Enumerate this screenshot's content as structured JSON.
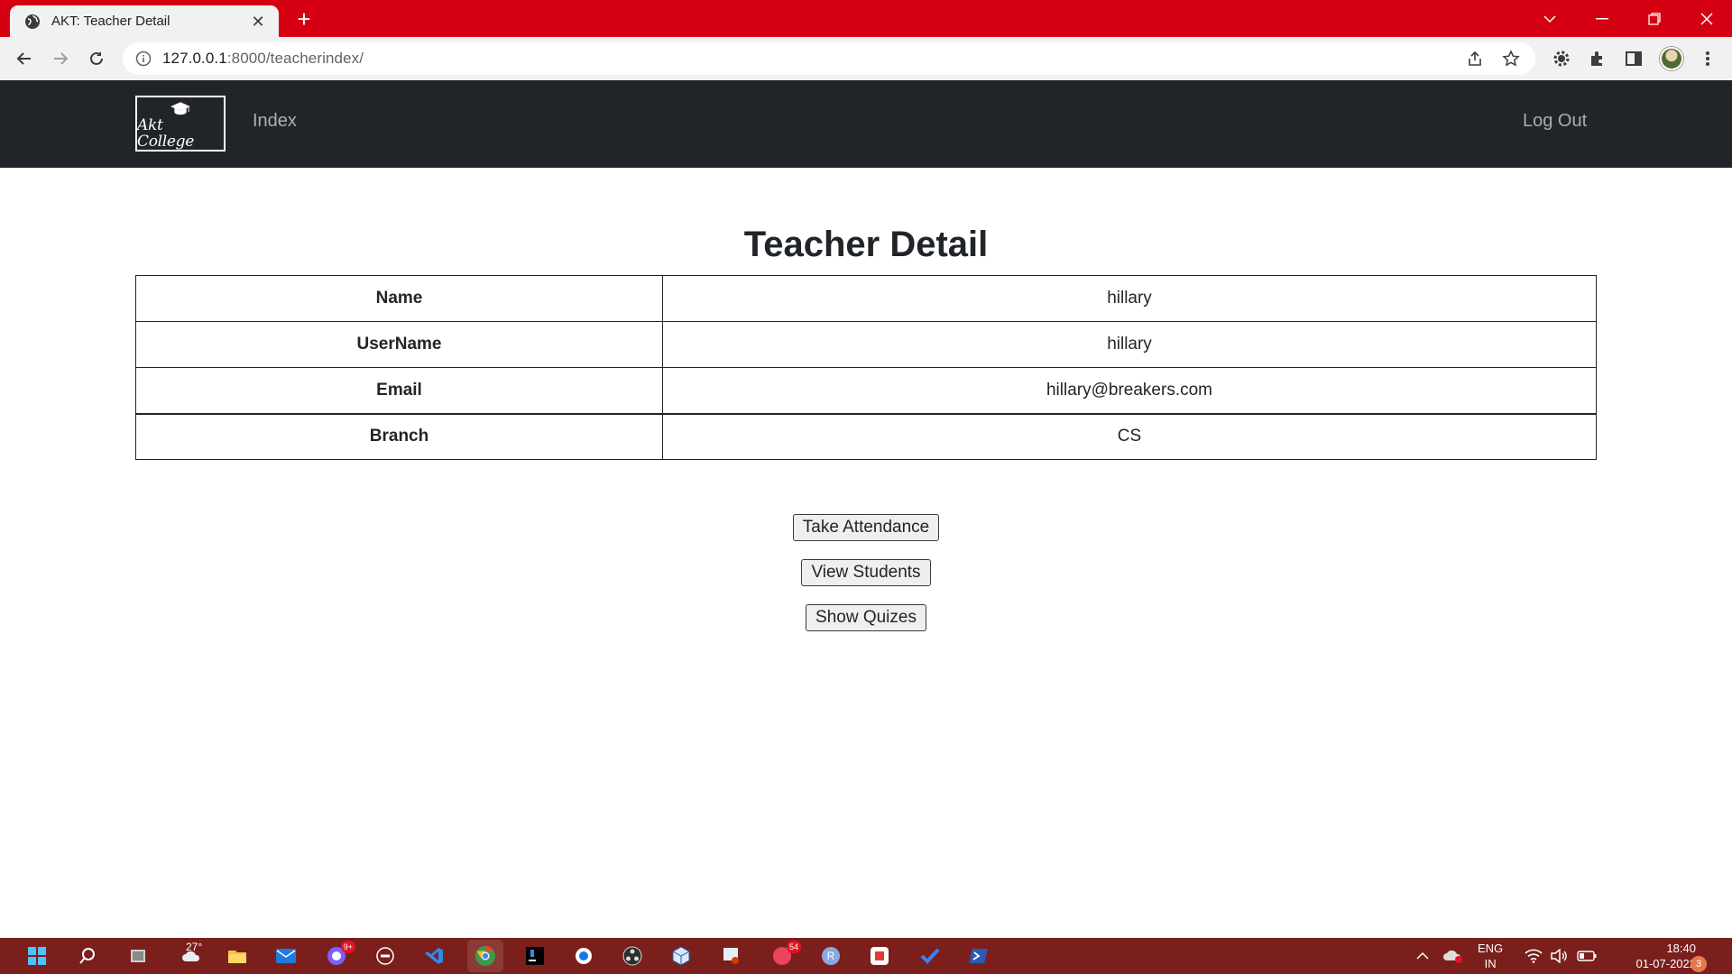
{
  "browser": {
    "tab_title": "AKT: Teacher Detail",
    "url_host": "127.0.0.1",
    "url_rest": ":8000/teacherindex/"
  },
  "navbar": {
    "brand_text": "Akt College",
    "index_link": "Index",
    "logout_link": "Log Out"
  },
  "page": {
    "heading": "Teacher Detail",
    "rows": [
      {
        "label": "Name",
        "value": "hillary"
      },
      {
        "label": "UserName",
        "value": "hillary"
      },
      {
        "label": "Email",
        "value": "hillary@breakers.com"
      },
      {
        "label": "Branch",
        "value": "CS"
      }
    ],
    "buttons": {
      "take_attendance": "Take Attendance",
      "view_students": "View Students",
      "show_quizes": "Show Quizes"
    }
  },
  "taskbar": {
    "weather_temp": "27°",
    "badge_chat": "9+",
    "badge_mail": "54",
    "language": "ENG",
    "region": "IN",
    "time": "18:40",
    "date": "01-07-2022",
    "notification_count": "3"
  },
  "colors": {
    "titlebar": "#d50012",
    "navbar": "#212529",
    "taskbar": "#7a1f1c"
  }
}
